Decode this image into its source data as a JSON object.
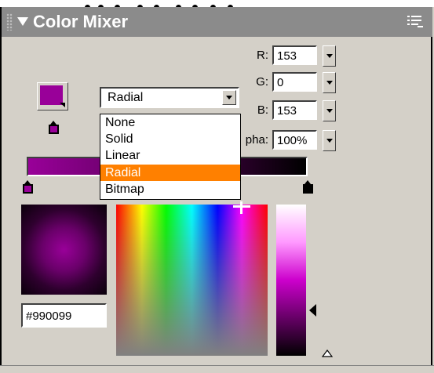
{
  "panel": {
    "title": "Color Mixer",
    "icons": [
      "grip-icon",
      "collapse-arrow-icon",
      "panel-menu-icon"
    ]
  },
  "fill": {
    "swatch_color": "#990099",
    "type_selected": "Radial",
    "type_options": [
      "None",
      "Solid",
      "Linear",
      "Radial",
      "Bitmap"
    ],
    "highlight_color": "#ff8000"
  },
  "channels": [
    {
      "label": "R:",
      "value": "153"
    },
    {
      "label": "G:",
      "value": "0"
    },
    {
      "label": "B:",
      "value": "153"
    },
    {
      "label": "pha:",
      "value": "100%"
    }
  ],
  "gradient": {
    "left_color": "#990099",
    "right_color": "#000000"
  },
  "hex": {
    "value": "#990099"
  }
}
